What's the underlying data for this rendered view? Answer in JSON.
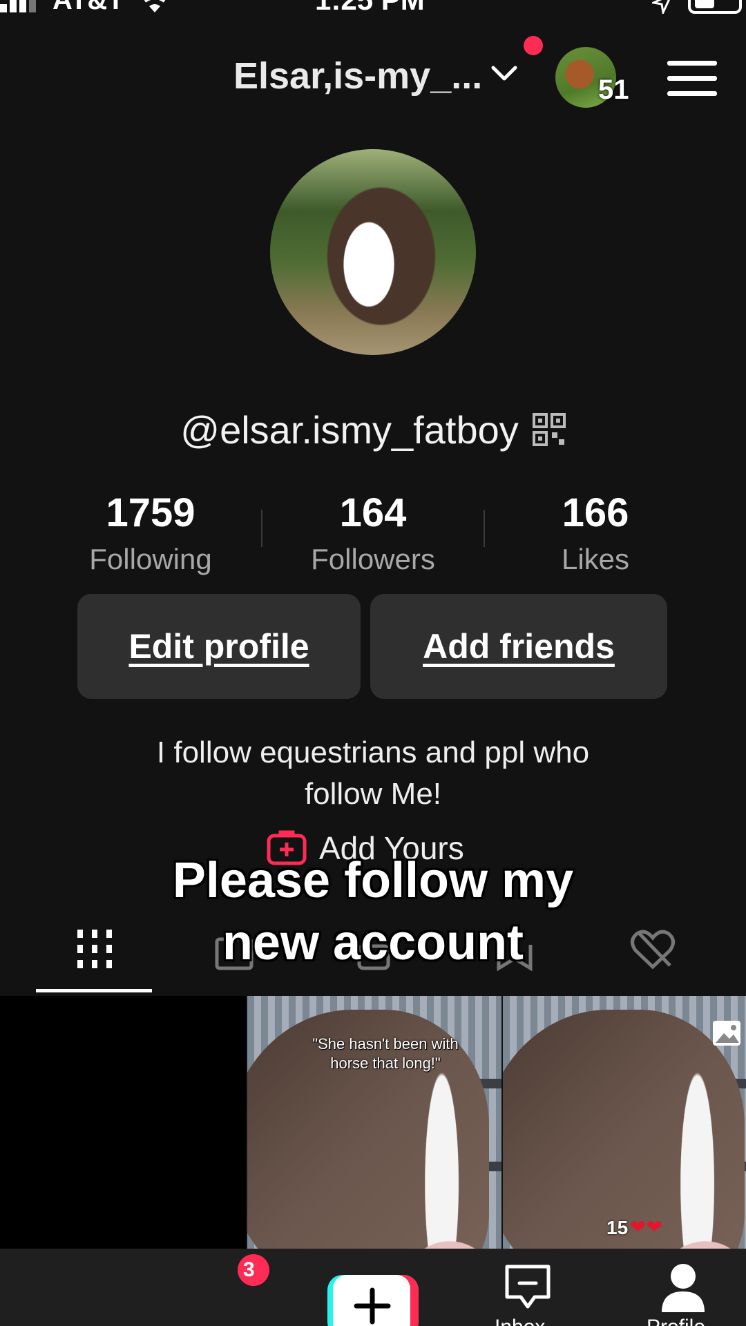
{
  "status_bar": {
    "carrier": "AT&T",
    "time": "1:25 PM"
  },
  "header": {
    "account_name": "Elsar,is-my_...",
    "switch_count": "51"
  },
  "profile": {
    "username": "@elsar.ismy_fatboy",
    "stats": [
      {
        "value": "1759",
        "label": "Following"
      },
      {
        "value": "164",
        "label": "Followers"
      },
      {
        "value": "166",
        "label": "Likes"
      }
    ],
    "edit_button": "Edit profile",
    "add_friends_button": "Add friends",
    "bio_line1": "I follow equestrians and ppl who",
    "bio_line2": "follow Me!",
    "add_yours": "Add Yours"
  },
  "overlay_caption": {
    "line1": "Please follow my",
    "line2": "new account"
  },
  "grid": {
    "cell2_text": "\"She hasn't been with horse that long!\"",
    "cell3_count": "15",
    "cell3_hearts": "❤❤"
  },
  "bottom_nav": {
    "badge_count": "3",
    "inbox_label": "Inbox",
    "profile_label": "Profile"
  },
  "icons": {
    "signal": "signal-icon",
    "wifi": "wifi-icon",
    "location": "location-arrow-icon",
    "battery": "battery-icon",
    "chevron": "chevron-down-icon",
    "menu": "hamburger-menu-icon",
    "qr": "qr-code-icon",
    "add_yours": "add-yours-plus-icon",
    "tabs": [
      "videos-grid-icon",
      "repost-icon",
      "locked-icon",
      "favorites-icon",
      "liked-hidden-icon"
    ],
    "photo": "photo-icon",
    "create": "create-plus-icon",
    "inbox": "inbox-icon",
    "profile": "profile-icon"
  },
  "colors": {
    "background": "#121212",
    "accent_red": "#fe2c55",
    "accent_cyan": "#25f4ee",
    "button_bg": "#2f2f2f",
    "muted_text": "#a8a8a8"
  }
}
